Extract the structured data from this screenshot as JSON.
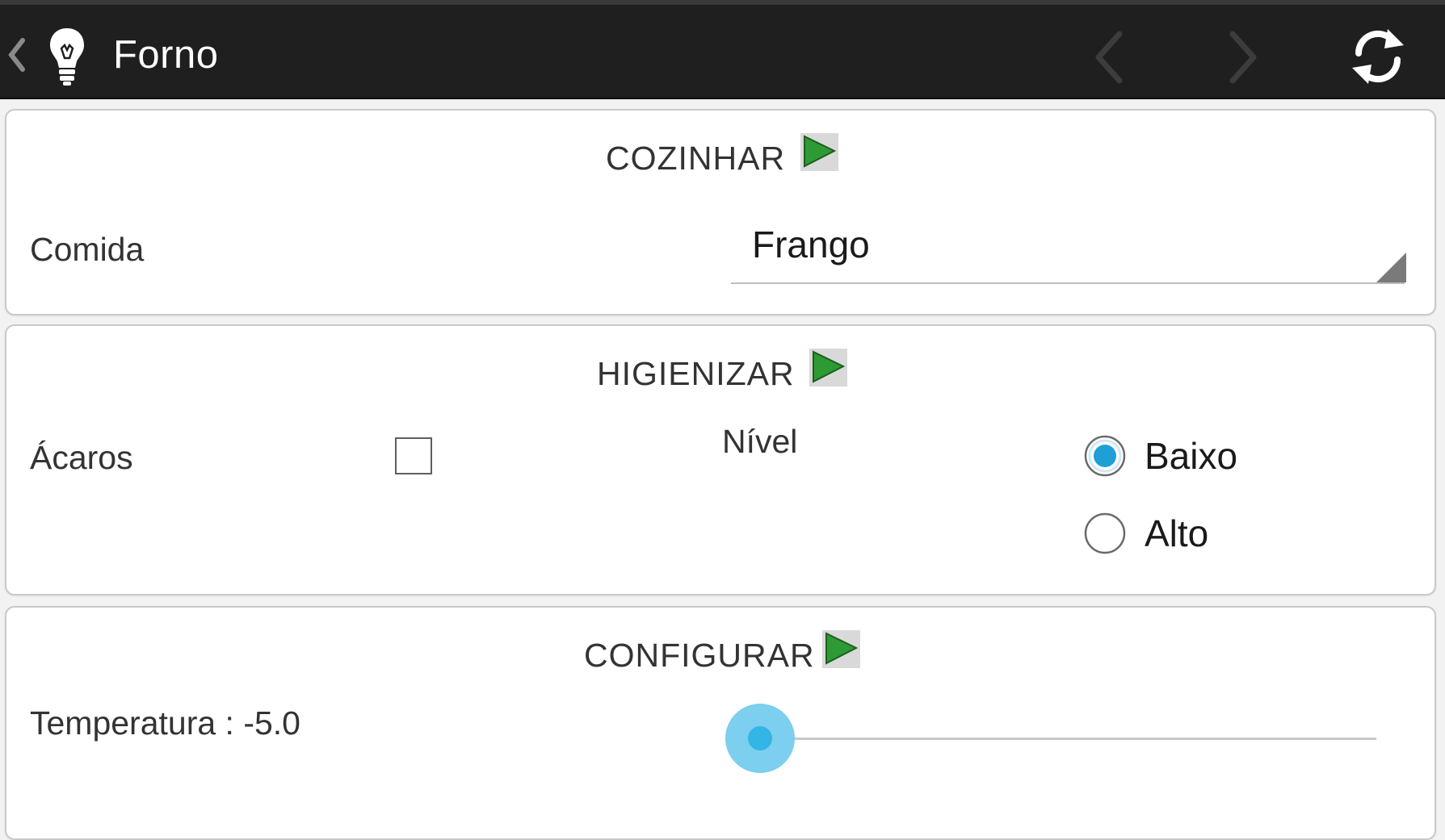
{
  "action_bar": {
    "title": "Forno",
    "background_color": "#1f1f1f",
    "icons": [
      "back-chevron-icon",
      "lightbulb-icon",
      "chevron-left-icon",
      "chevron-right-icon",
      "refresh-icon"
    ]
  },
  "sections": {
    "cozinhar": {
      "title": "COZINHAR",
      "food_label": "Comida",
      "food_value": "Frango"
    },
    "higienizar": {
      "title": "HIGIENIZAR",
      "mites_label": "Ácaros",
      "mites_checked": false,
      "level_label": "Nível",
      "level_options": [
        "Baixo",
        "Alto"
      ],
      "level_selected": "Baixo"
    },
    "configurar": {
      "title": "CONFIGURAR",
      "temperature_label": "Temperatura : -5.0",
      "temperature_slider_level": 0
    }
  },
  "colors": {
    "accent": "#33b5e5",
    "play_green": "#2e9a33",
    "card_border": "#c9c9c9"
  }
}
